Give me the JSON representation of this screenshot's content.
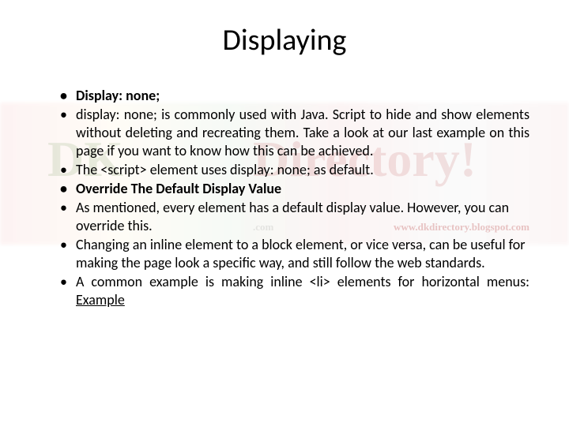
{
  "title": "Displaying",
  "bullets": {
    "b1": "Display: none;",
    "b2": "display: none; is commonly used with Java. Script to hide and show elements without deleting and recreating them. Take a look at our last example on this page if you want to know how this can be achieved.",
    "b3": "The <script> element uses display: none; as default.",
    "b4": "Override The Default Display Value",
    "b5": "As mentioned, every element has a default display value. However, you can override this.",
    "b6": "Changing an inline element to a block element, or vice versa, can be useful for making the page look a specific way, and still follow the web standards.",
    "b7_prefix": "A common example is making inline <li> elements for horizontal menus: ",
    "b7_link": "Example"
  },
  "watermark": {
    "text1": "DK",
    "text2": "Directory!",
    "url1": "www.dkdirectory.blogspot.com",
    "domain": ".com"
  }
}
